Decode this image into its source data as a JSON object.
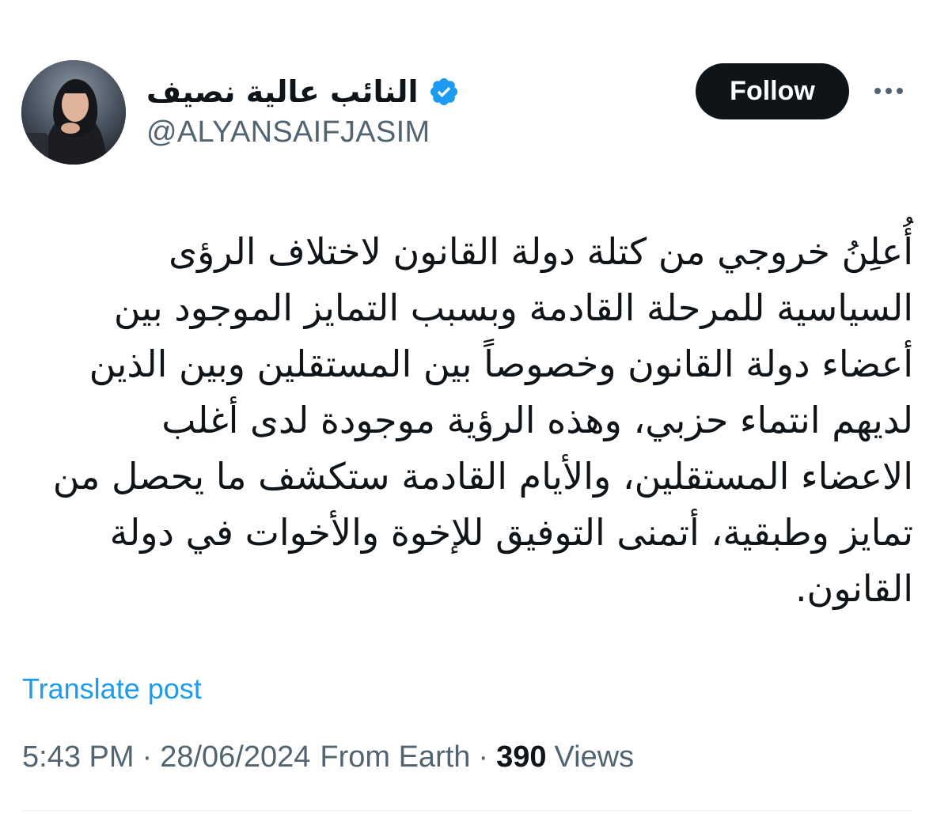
{
  "author": {
    "display_name": "النائب عالية نصيف",
    "handle": "@ALYANSAIFJASIM",
    "verified": true
  },
  "actions": {
    "follow_label": "Follow",
    "more_icon": "more-horizontal-icon"
  },
  "post": {
    "lines": [
      "أُعلِنُ خروجي من كتلة دولة القانون لاختلاف الرؤى",
      "السياسية للمرحلة القادمة وبسبب التمايز الموجود بين",
      "أعضاء دولة القانون وخصوصاً بين المستقلين وبين الذين",
      "لديهم انتماء حزبي، وهذه الرؤية موجودة لدى أغلب",
      "الاعضاء المستقلين، والأيام القادمة ستكشف ما يحصل من",
      "تمايز وطبقية، أتمنى التوفيق للإخوة والأخوات في دولة",
      "القانون."
    ]
  },
  "translate_label": "Translate post",
  "meta": {
    "time": "5:43 PM",
    "separator": "·",
    "date": "28/06/2024",
    "source": "From Earth",
    "views_count": "390",
    "views_label": "Views"
  },
  "colors": {
    "text": "#0f1419",
    "secondary": "#536471",
    "link": "#1d9bf0",
    "verified": "#1d9bf0",
    "button_bg": "#0f1419"
  }
}
